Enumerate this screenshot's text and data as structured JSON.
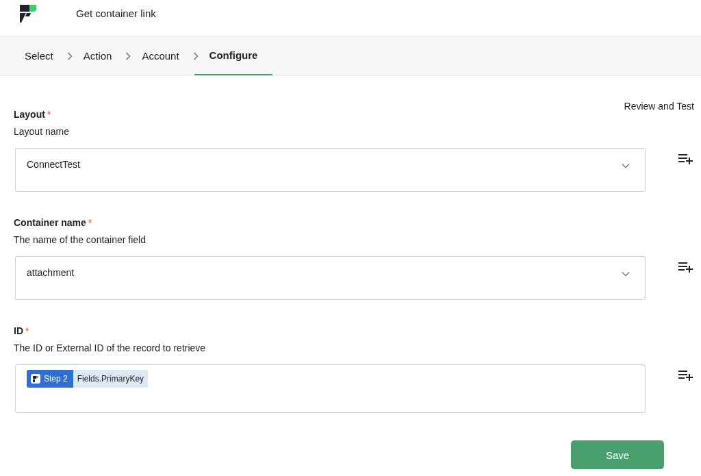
{
  "header": {
    "title": "Get container link"
  },
  "steps": [
    {
      "label": "Select",
      "selected": false
    },
    {
      "label": "Action",
      "selected": false
    },
    {
      "label": "Account",
      "selected": false
    },
    {
      "label": "Configure",
      "selected": true
    }
  ],
  "review_link": "Review and Test",
  "fields": [
    {
      "kind": "select",
      "label": "Layout",
      "required": "*",
      "description": "Layout name",
      "value": "ConnectTest"
    },
    {
      "kind": "select",
      "label": "Container name",
      "required": "*",
      "description": "The name of the container field",
      "value": "attachment"
    },
    {
      "kind": "token",
      "label": "ID",
      "required": "*",
      "description": "The ID or External ID of the record to retrieve",
      "token_step": "Step 2",
      "token_value": "Fields.PrimaryKey"
    }
  ],
  "save_button": "Save"
}
